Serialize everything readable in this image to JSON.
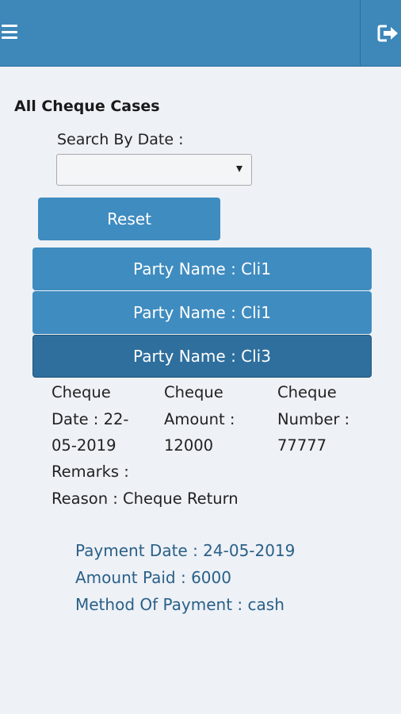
{
  "header": {
    "menu_icon": "hamburger-menu-icon",
    "logout_icon": "sign-out-icon",
    "bg_color": "#3d87b9"
  },
  "page": {
    "title": "All Cheque Cases",
    "search_label": "Search By Date :",
    "search_value": "",
    "reset_label": "Reset"
  },
  "parties": [
    {
      "label": "Party Name : Cli1"
    },
    {
      "label": "Party Name : Cli1"
    },
    {
      "label": "Party Name : Cli3"
    }
  ],
  "details": {
    "cheque_date": [
      "Cheque",
      "Date : 22-",
      "05-2019"
    ],
    "cheque_amount": [
      "Cheque",
      "Amount :",
      "12000"
    ],
    "cheque_number": [
      "Cheque",
      "Number :",
      "77777"
    ],
    "remarks": "Remarks :",
    "reason": "Reason : Cheque Return"
  },
  "payment": {
    "date": "Payment Date : 24-05-2019",
    "amount": "Amount Paid : 6000",
    "method": "Method Of Payment : cash"
  }
}
